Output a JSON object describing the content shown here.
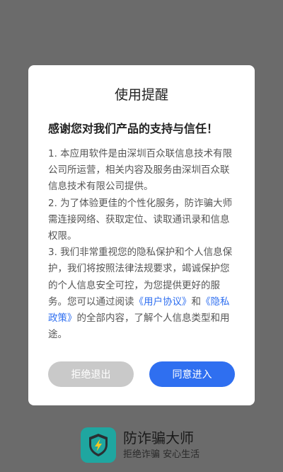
{
  "dialog": {
    "title": "使用提醒",
    "subtitle": "感谢您对我们产品的支持与信任！",
    "paragraph1": "1. 本应用软件是由深圳百众联信息技术有限公司所运营，相关内容及服务由深圳百众联信息技术有限公司提供。",
    "paragraph2": "2. 为了体验更佳的个性化服务，防诈骗大师需连接网络、获取定位、读取通讯录和信息权限。",
    "paragraph3_part1": "3. 我们非常重视您的隐私保护和个人信息保护，我们将按照法律法规要求，竭诚保护您的个人信息安全可控，为您提供更好的服务。您可以通过阅读",
    "user_agreement_link": "《用户协议》",
    "paragraph3_and": "和",
    "privacy_policy_link": "《隐私政策》",
    "paragraph3_part2": "的全部内容，了解个人信息类型和用途。",
    "reject_label": "拒绝退出",
    "agree_label": "同意进入"
  },
  "brand": {
    "app_icon": "shield-lightning-icon",
    "app_name": "防诈骗大师",
    "slogan": "拒绝诈骗 安心生活"
  },
  "colors": {
    "overlay": "#6b6b6b",
    "accent": "#2f6ff0",
    "reject_button": "#c9c9c9",
    "app_icon_bg": "#1fa6a0"
  }
}
